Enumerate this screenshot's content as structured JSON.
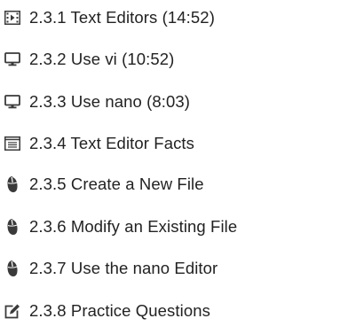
{
  "course_section": {
    "items": [
      {
        "icon": "video-icon",
        "label": "2.3.1 Text Editors (14:52)"
      },
      {
        "icon": "monitor-icon",
        "label": "2.3.2 Use vi (10:52)"
      },
      {
        "icon": "monitor-icon",
        "label": "2.3.3 Use nano (8:03)"
      },
      {
        "icon": "document-icon",
        "label": "2.3.4 Text Editor Facts"
      },
      {
        "icon": "mouse-icon",
        "label": "2.3.5 Create a New File"
      },
      {
        "icon": "mouse-icon",
        "label": "2.3.6 Modify an Existing File"
      },
      {
        "icon": "mouse-icon",
        "label": "2.3.7 Use the nano Editor"
      },
      {
        "icon": "quiz-icon",
        "label": "2.3.8 Practice Questions"
      }
    ]
  },
  "colors": {
    "text": "#222222",
    "icon": "#3a3a3a"
  }
}
